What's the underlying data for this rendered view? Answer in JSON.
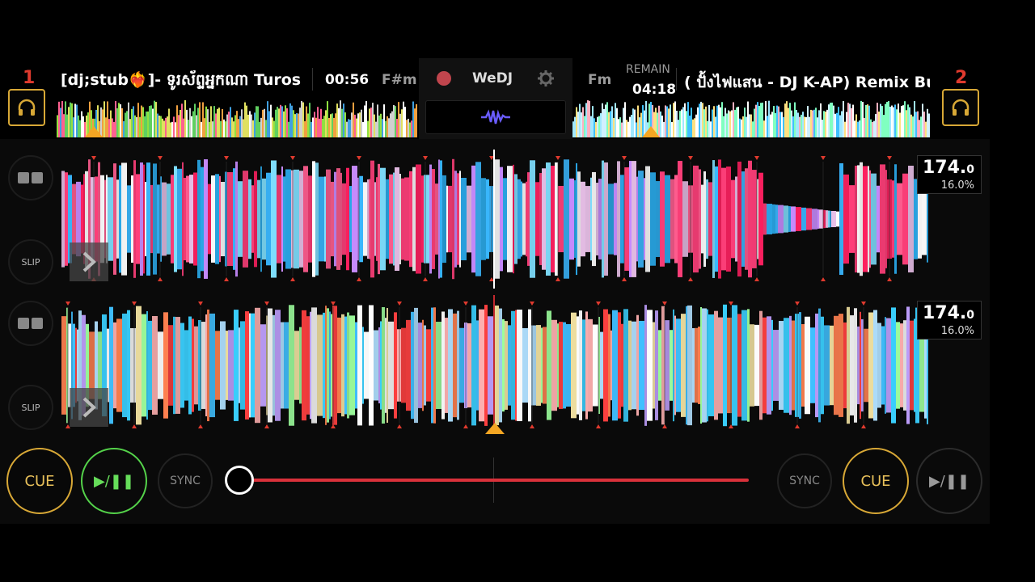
{
  "deck1": {
    "number": "1",
    "title": "[dj;stub❤️‍🔥]-  ទូរស័ព្ទអ្នកណា Turos",
    "time": "00:56",
    "key": "F#m",
    "bpm_main": "174.",
    "bpm_decimal": "0",
    "pitch": "16.0%",
    "slip_label": "SLIP",
    "cue_label": "CUE",
    "play_label": "▶/❚❚",
    "sync_label": "SYNC",
    "playing": true
  },
  "deck2": {
    "number": "2",
    "title": "( ปั้งไฟแสน - DJ K-AP) Remix Bu",
    "remain_label": "REMAIN",
    "time": "04:18",
    "key": "Fm",
    "bpm_main": "174.",
    "bpm_decimal": "0",
    "pitch": "16.0%",
    "slip_label": "SLIP",
    "cue_label": "CUE",
    "play_label": "▶/❚❚",
    "sync_label": "SYNC",
    "playing": false
  },
  "center": {
    "app_name": "WeDJ",
    "record_icon": "record-icon",
    "settings_icon": "gear-icon",
    "waveform_icon": "waveform-icon"
  },
  "crossfader": {
    "position": 0.0
  },
  "colors": {
    "deck_number": "#e03a2e",
    "cue_ring": "#d8a836",
    "play_active": "#54d24a",
    "crossfader_track": "#d9313a",
    "beat_marker": "#e03a2e",
    "playhead_triangle": "#f5a623"
  }
}
